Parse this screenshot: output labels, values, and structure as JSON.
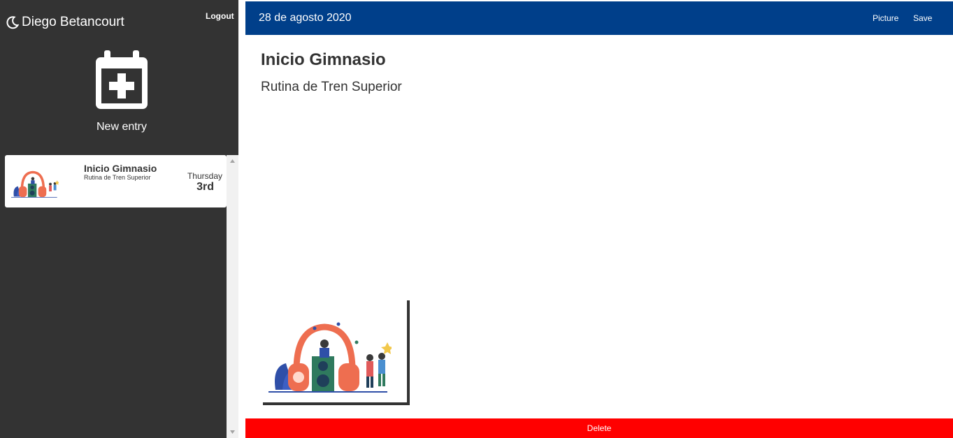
{
  "sidebar": {
    "user_name": "Diego Betancourt",
    "logout_label": "Logout",
    "new_entry_label": "New entry",
    "entries": [
      {
        "title": "Inicio Gimnasio",
        "subtitle": "Rutina de Tren Superior",
        "day": "Thursday",
        "date": "3rd",
        "thumbnail": "music-illustration"
      }
    ]
  },
  "topbar": {
    "date": "28 de agosto 2020",
    "picture_label": "Picture",
    "save_label": "Save"
  },
  "main": {
    "title": "Inicio Gimnasio",
    "body": "Rutina de Tren Superior",
    "picture": "music-illustration"
  },
  "footer": {
    "delete_label": "Delete"
  },
  "colors": {
    "sidebar_bg": "#333333",
    "topbar_bg": "#003f8a",
    "delete_bg": "#ff0000",
    "text_dark": "#333333"
  },
  "icons": [
    "moon-icon",
    "calendar-plus-icon",
    "scroll-up-icon",
    "scroll-down-icon"
  ]
}
